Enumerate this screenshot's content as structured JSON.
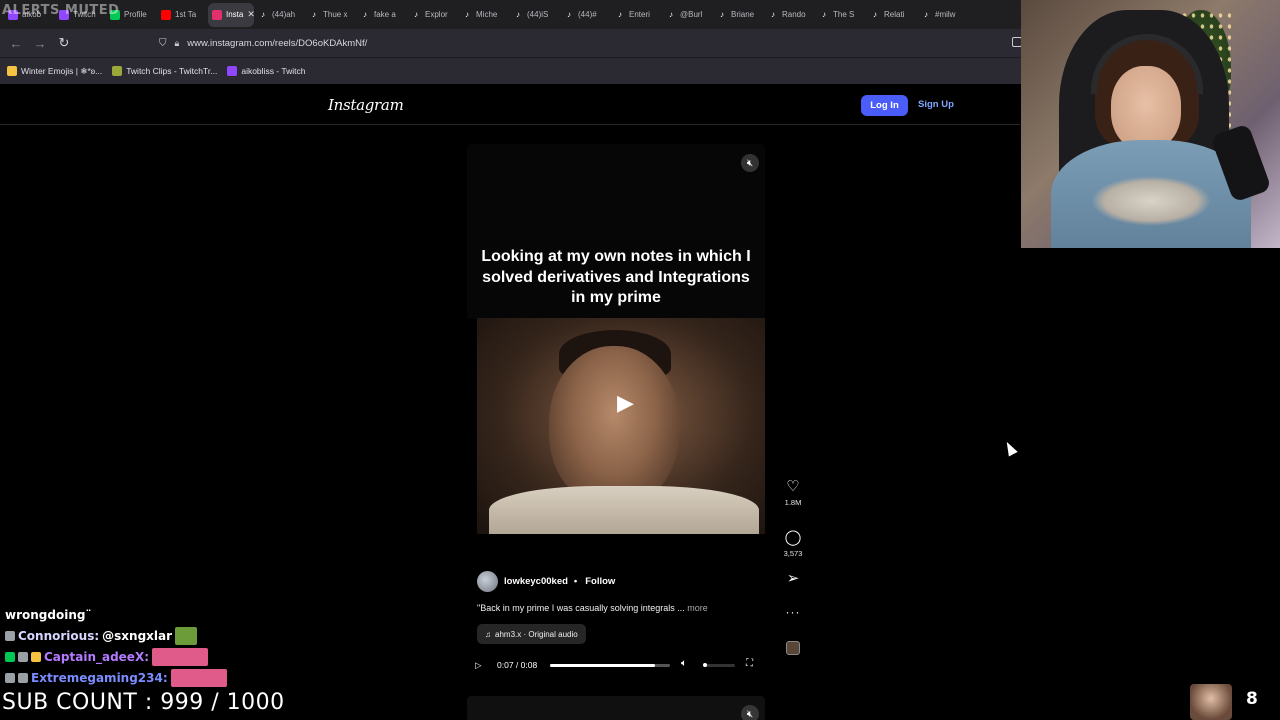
{
  "browser": {
    "tabs": [
      {
        "label": "aikob",
        "color": "#9146ff",
        "active": false
      },
      {
        "label": "Twitch",
        "color": "#9146ff",
        "active": false
      },
      {
        "label": "Profile",
        "color": "#00c853",
        "active": false
      },
      {
        "label": "1st Ta",
        "color": "#ff0000",
        "active": false
      },
      {
        "label": "Insta",
        "color": "#e1306c",
        "active": true
      },
      {
        "label": "(44)ah",
        "color": "#ffffff",
        "active": false
      },
      {
        "label": "Thue x",
        "color": "#ffffff",
        "active": false
      },
      {
        "label": "fake a",
        "color": "#ffffff",
        "active": false
      },
      {
        "label": "Explor",
        "color": "#ffffff",
        "active": false
      },
      {
        "label": "Miche",
        "color": "#ffffff",
        "active": false
      },
      {
        "label": "(44)iS",
        "color": "#ffffff",
        "active": false
      },
      {
        "label": "(44)#",
        "color": "#ffffff",
        "active": false
      },
      {
        "label": "Enteri",
        "color": "#ffffff",
        "active": false
      },
      {
        "label": "@Burl",
        "color": "#ffffff",
        "active": false
      },
      {
        "label": "Briane",
        "color": "#ffffff",
        "active": false
      },
      {
        "label": "Rando",
        "color": "#ffffff",
        "active": false
      },
      {
        "label": "The S",
        "color": "#ffffff",
        "active": false
      },
      {
        "label": "Relati",
        "color": "#ffffff",
        "active": false
      },
      {
        "label": "#milw",
        "color": "#ffffff",
        "active": false
      }
    ],
    "url": "www.instagram.com/reels/DO6oKDAkmNf/",
    "bookmarks": [
      {
        "label": "Winter Emojis | ❄*ʚ...",
        "color": "#f5c242"
      },
      {
        "label": "Twitch Clips - TwitchTr...",
        "color": "#9aa83a"
      },
      {
        "label": "aikobliss - Twitch",
        "color": "#9146ff"
      }
    ]
  },
  "overlay_top_text": "ALERTS MUTED",
  "instagram": {
    "logo": "Instagram",
    "login_label": "Log In",
    "signup_label": "Sign Up",
    "reel": {
      "caption": "Looking at my own notes in which I solved derivatives and Integrations in my prime",
      "author": "lowkeyc00ked",
      "separator": "•",
      "follow_label": "Follow",
      "description": "\"Back in my prime I was casually solving integrals ...",
      "more_label": "more",
      "audio": "ahm3.x · Original audio",
      "time": "0:07 / 0:08",
      "progress": 0.875
    },
    "actions": {
      "likes": "1.8M",
      "comments": "3,573"
    }
  },
  "stream": {
    "chat": [
      {
        "user": "",
        "message": "wrongdoing¨",
        "color": "#ffffff",
        "badges": []
      },
      {
        "user": "Connorious:",
        "message": "@sxngxlar",
        "color": "#d6d6ff",
        "badges": [
          "#9aa0a6"
        ],
        "emote": "#6c9b3a"
      },
      {
        "user": "Captain_adeeX:",
        "message": "",
        "color": "#b57bff",
        "badges": [
          "#00c853",
          "#9aa0a6",
          "#f5c242"
        ],
        "emote": "#e05a8a"
      },
      {
        "user": "Extremegaming234:",
        "message": "",
        "color": "#7b8cff",
        "badges": [
          "#9aa0a6",
          "#9aa0a6"
        ],
        "emote": "#e05a8a"
      }
    ],
    "sub_count": "SUB COUNT : 999 / 1000",
    "viewer_count": "8"
  }
}
